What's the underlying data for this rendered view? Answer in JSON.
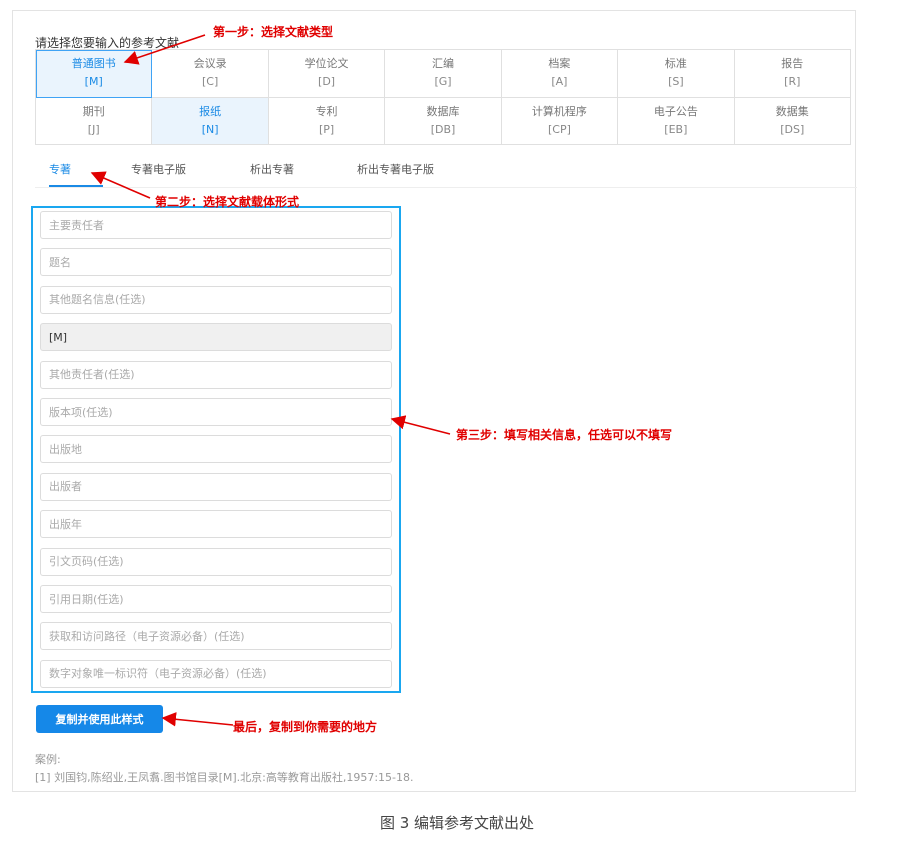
{
  "heading": "请选择您要输入的参考文献",
  "doc_types": [
    {
      "name": "普通图书",
      "code": "[M]",
      "state": "selected"
    },
    {
      "name": "会议录",
      "code": "[C]",
      "state": ""
    },
    {
      "name": "学位论文",
      "code": "[D]",
      "state": ""
    },
    {
      "name": "汇编",
      "code": "[G]",
      "state": ""
    },
    {
      "name": "档案",
      "code": "[A]",
      "state": ""
    },
    {
      "name": "标准",
      "code": "[S]",
      "state": ""
    },
    {
      "name": "报告",
      "code": "[R]",
      "state": ""
    },
    {
      "name": "期刊",
      "code": "[J]",
      "state": ""
    },
    {
      "name": "报纸",
      "code": "[N]",
      "state": "active"
    },
    {
      "name": "专利",
      "code": "[P]",
      "state": ""
    },
    {
      "name": "数据库",
      "code": "[DB]",
      "state": ""
    },
    {
      "name": "计算机程序",
      "code": "[CP]",
      "state": ""
    },
    {
      "name": "电子公告",
      "code": "[EB]",
      "state": ""
    },
    {
      "name": "数据集",
      "code": "[DS]",
      "state": ""
    }
  ],
  "tabs": [
    "专著",
    "专著电子版",
    "析出专著",
    "析出专著电子版"
  ],
  "fields": [
    {
      "placeholder": "主要责任者",
      "value": ""
    },
    {
      "placeholder": "题名",
      "value": ""
    },
    {
      "placeholder": "其他题名信息(任选)",
      "value": ""
    },
    {
      "placeholder": "",
      "value": "[M]"
    },
    {
      "placeholder": "其他责任者(任选)",
      "value": ""
    },
    {
      "placeholder": "版本项(任选)",
      "value": ""
    },
    {
      "placeholder": "出版地",
      "value": ""
    },
    {
      "placeholder": "出版者",
      "value": ""
    },
    {
      "placeholder": "出版年",
      "value": ""
    },
    {
      "placeholder": "引文页码(任选)",
      "value": ""
    },
    {
      "placeholder": "引用日期(任选)",
      "value": ""
    },
    {
      "placeholder": "获取和访问路径（电子资源必备）(任选)",
      "value": ""
    },
    {
      "placeholder": "数字对象唯一标识符（电子资源必备）(任选)",
      "value": ""
    }
  ],
  "copy_button": "复制并使用此样式",
  "example_label": "案例:",
  "example_text": "[1] 刘国钧,陈绍业,王凤翥.图书馆目录[M].北京:高等教育出版社,1957:15-18.",
  "annotations": {
    "step1": "第一步：选择文献类型",
    "step2": "第二步：选择文献载体形式",
    "step3": "第三步：填写相关信息，任选可以不填写",
    "last": "最后，复制到你需要的地方"
  },
  "caption": "图 3 编辑参考文献出处",
  "colors": {
    "accent": "#1a8ae5",
    "annotation": "#e00000",
    "form_border": "#1aa7f0"
  }
}
